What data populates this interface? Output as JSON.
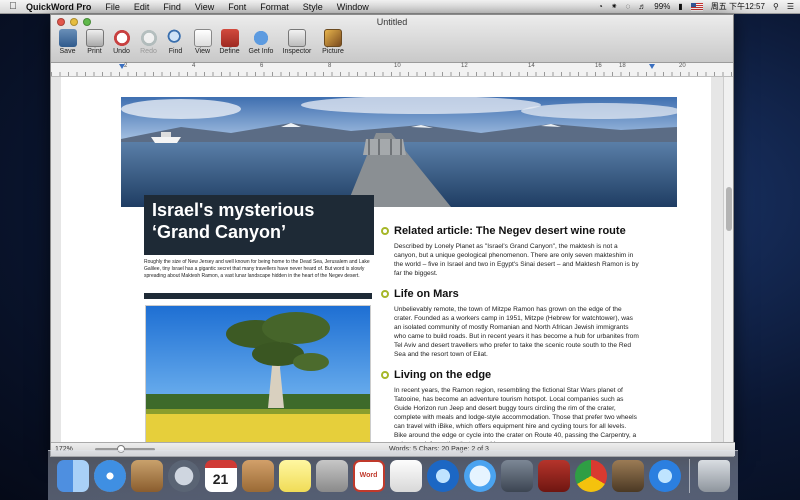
{
  "menubar": {
    "app_name": "QuickWord Pro",
    "items": [
      "File",
      "Edit",
      "Find",
      "View",
      "Font",
      "Format",
      "Style",
      "Window"
    ],
    "battery": "99%",
    "clock": "周五 下午12:57"
  },
  "window": {
    "title": "Untitled",
    "toolbar": [
      {
        "label": "Save",
        "icon": "save-icon"
      },
      {
        "label": "Print",
        "icon": "print-icon"
      },
      {
        "label": "Undo",
        "icon": "undo-icon"
      },
      {
        "label": "Redo",
        "icon": "redo-icon"
      },
      {
        "label": "Find",
        "icon": "find-icon"
      },
      {
        "label": "View",
        "icon": "view-icon"
      },
      {
        "label": "Define",
        "icon": "define-icon"
      },
      {
        "label": "Get Info",
        "icon": "info-icon"
      },
      {
        "label": "Inspector",
        "icon": "inspector-icon"
      },
      {
        "label": "Picture",
        "icon": "picture-icon"
      }
    ],
    "ruler_numbers": [
      "2",
      "4",
      "6",
      "8",
      "10",
      "12",
      "14",
      "16",
      "18",
      "20"
    ]
  },
  "document": {
    "headline_line1": "Israel's mysterious",
    "headline_line2": "‘Grand Canyon’",
    "intro": "Roughly the size of New Jersey and well known for being home to the Dead Sea, Jerusalem and Lake Galilee, tiny Israel has a gigantic secret that many travellers have never heard of. But word is slowly spreading about Maktesh Ramon, a vast lunar landscape hidden in the heart of the Negev desert.",
    "sections": [
      {
        "heading": "Related article: The Negev desert wine route",
        "body": "Described by Lonely Planet as \"Israel's Grand Canyon\", the maktesh is not a canyon, but a unique geological phenomenon. There are only seven makteshim in the world – five in Israel and two in Egypt's Sinai desert – and Maktesh Ramon is by far the biggest."
      },
      {
        "heading": "Life on Mars",
        "body": "Unbelievably remote, the town of Mitzpe Ramon has grown on the edge of the crater. Founded as a workers camp in 1951, Mitzpe (Hebrew for watchtower), was an isolated community of mostly Romanian and North African Jewish immigrants who came to build roads. But in recent years it has become a hub for urbanites from Tel Aviv and desert travellers who prefer to take the scenic route south to the Red Sea and the resort town of Eilat."
      },
      {
        "heading": "Living on the edge",
        "body": "In recent years, the Ramon region, resembling the fictional Star Wars planet of Tatooine, has become an adventure tourism hotspot. Local companies such as Guide Horizon run Jeep and desert buggy tours circling the rim of the crater, complete with meals and lodge-style accommodation. Those that prefer two wheels can travel with iBike, which offers equipment hire and cycling tours for all levels. Bike around the edge or cycle into the crater on Route 40, passing the Carpentry, a unique rock formation that resembles"
      }
    ]
  },
  "statusbar": {
    "zoom": "172%",
    "stats": "Words: 5  Chars: 20  Page: 2 of 3"
  },
  "dock": {
    "calendar_day": "21",
    "word_label": "Word"
  }
}
